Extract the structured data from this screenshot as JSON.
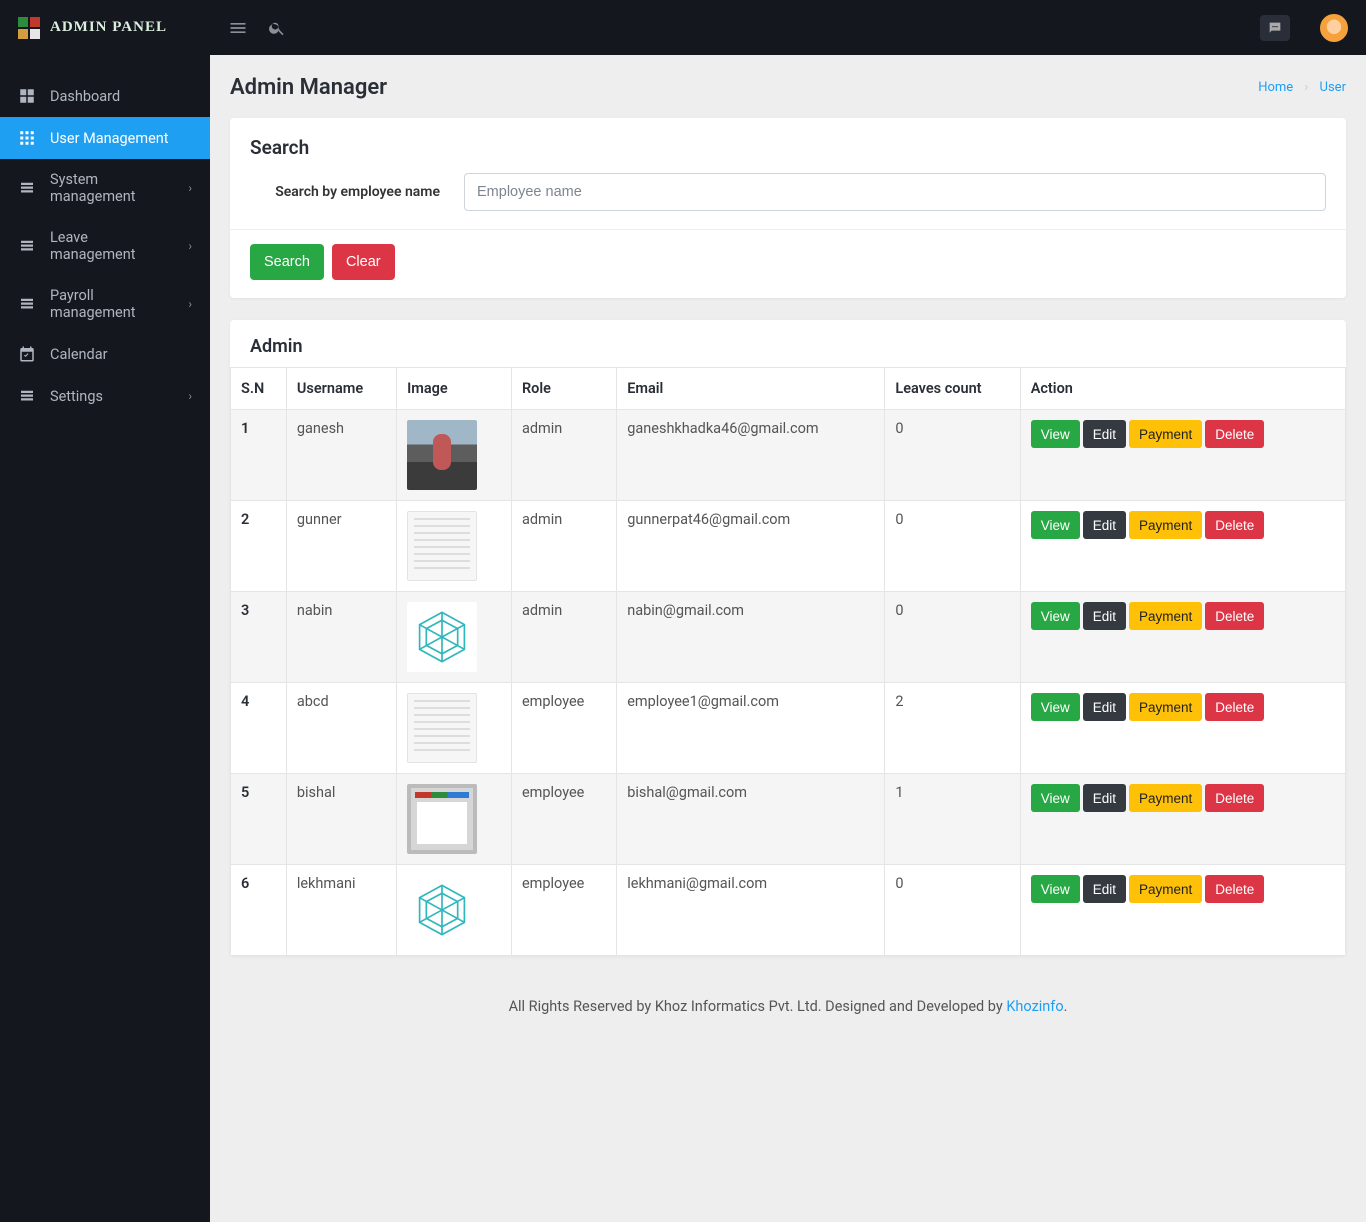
{
  "brand": {
    "text": "ADMIN PANEL"
  },
  "sidebar": {
    "items": [
      {
        "label": "Dashboard",
        "icon": "grid",
        "has_sub": false
      },
      {
        "label": "User Management",
        "icon": "grid4",
        "has_sub": false,
        "active": true
      },
      {
        "label": "System management",
        "icon": "list",
        "has_sub": true
      },
      {
        "label": "Leave management",
        "icon": "list",
        "has_sub": true
      },
      {
        "label": "Payroll management",
        "icon": "list",
        "has_sub": true
      },
      {
        "label": "Calendar",
        "icon": "calendar",
        "has_sub": false
      },
      {
        "label": "Settings",
        "icon": "list",
        "has_sub": true
      }
    ]
  },
  "page": {
    "title": "Admin Manager",
    "breadcrumb": {
      "home": "Home",
      "current": "User"
    }
  },
  "search_card": {
    "heading": "Search",
    "label": "Search by employee name",
    "placeholder": "Employee name",
    "search_btn": "Search",
    "clear_btn": "Clear"
  },
  "table_card": {
    "heading": "Admin",
    "columns": [
      "S.N",
      "Username",
      "Image",
      "Role",
      "Email",
      "Leaves count",
      "Action"
    ],
    "actions": {
      "view": "View",
      "edit": "Edit",
      "payment": "Payment",
      "delete": "Delete"
    },
    "rows": [
      {
        "sn": "1",
        "username": "ganesh",
        "thumb": "photo",
        "role": "admin",
        "email": "ganeshkhadka46@gmail.com",
        "leaves": "0"
      },
      {
        "sn": "2",
        "username": "gunner",
        "thumb": "doc",
        "role": "admin",
        "email": "gunnerpat46@gmail.com",
        "leaves": "0"
      },
      {
        "sn": "3",
        "username": "nabin",
        "thumb": "hexicon",
        "role": "admin",
        "email": "nabin@gmail.com",
        "leaves": "0"
      },
      {
        "sn": "4",
        "username": "abcd",
        "thumb": "doc",
        "role": "employee",
        "email": "employee1@gmail.com",
        "leaves": "2"
      },
      {
        "sn": "5",
        "username": "bishal",
        "thumb": "app",
        "role": "employee",
        "email": "bishal@gmail.com",
        "leaves": "1"
      },
      {
        "sn": "6",
        "username": "lekhmani",
        "thumb": "hexicon",
        "role": "employee",
        "email": "lekhmani@gmail.com",
        "leaves": "0"
      }
    ]
  },
  "footer": {
    "text_left": "All Rights Reserved by Khoz Informatics Pvt. Ltd. Designed and Developed by ",
    "link": "Khozinfo",
    "text_right": "."
  }
}
